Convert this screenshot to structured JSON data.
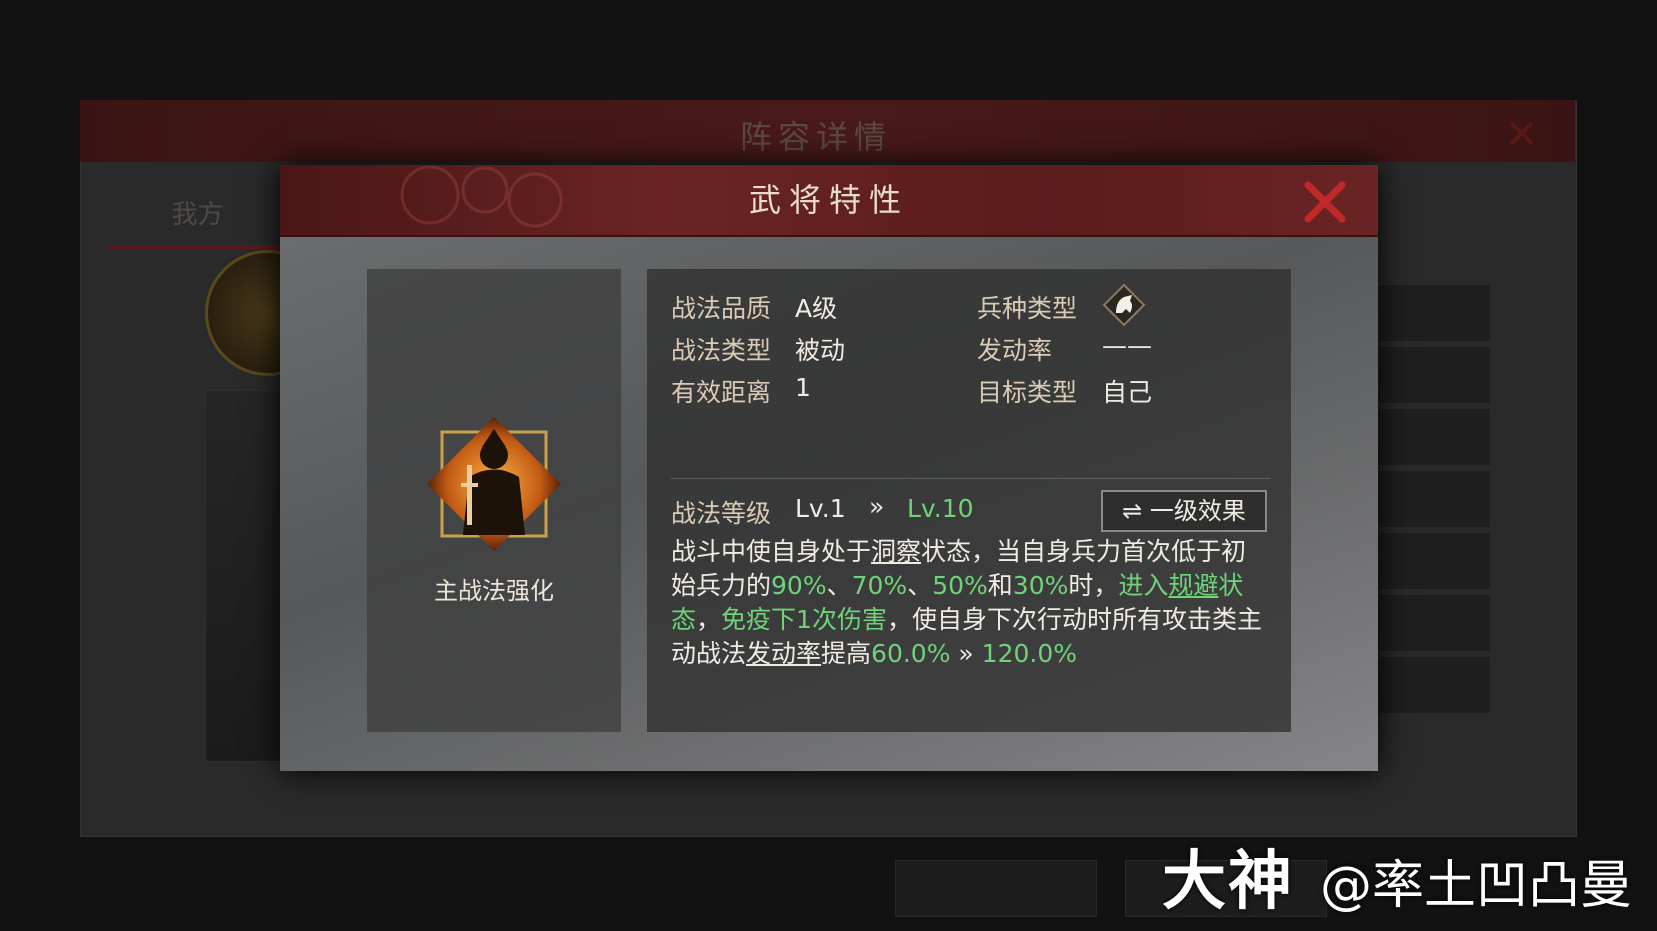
{
  "background": {
    "title": "阵容详情",
    "tab": "我方"
  },
  "dialog": {
    "title": "武将特性",
    "skill_name": "主战法强化",
    "attributes": {
      "quality_label": "战法品质",
      "quality_value": "A级",
      "type_label": "战法类型",
      "type_value": "被动",
      "range_label": "有效距离",
      "range_value": "1",
      "troop_label": "兵种类型",
      "troop_icon": "cavalry-horse-icon",
      "rate_label": "发动率",
      "rate_value": "——",
      "target_label": "目标类型",
      "target_value": "自己"
    },
    "level": {
      "label": "战法等级",
      "current": "Lv.1",
      "arrow": "»",
      "next": "Lv.10"
    },
    "effect_button": "一级效果",
    "description": {
      "p1": "战斗中使自身处于",
      "k1": "洞察",
      "p2": "状态，当自身兵力首次低于初始兵力的",
      "v1": "90%",
      "s1": "、",
      "v2": "70%",
      "s2": "、",
      "v3": "50%",
      "p3": "和",
      "v4": "30%",
      "p4": "时，",
      "g1": "进入",
      "k2": "规避",
      "g2": "状态",
      "p5": "，",
      "g3": "免疫下",
      "v5": "1",
      "g4": "次伤害",
      "p6": "，使自身下次行动时所有攻击类主动战法",
      "k3": "发动率",
      "p7": "提高",
      "v6": "60.0%",
      "arrow": " » ",
      "v7": "120.0%"
    }
  },
  "watermark": {
    "brand": "大神",
    "user": "@率土凹凸曼"
  },
  "colors": {
    "accent_green": "#6fd37a",
    "close_red": "#c0282a",
    "header_red": "#6a2424"
  }
}
